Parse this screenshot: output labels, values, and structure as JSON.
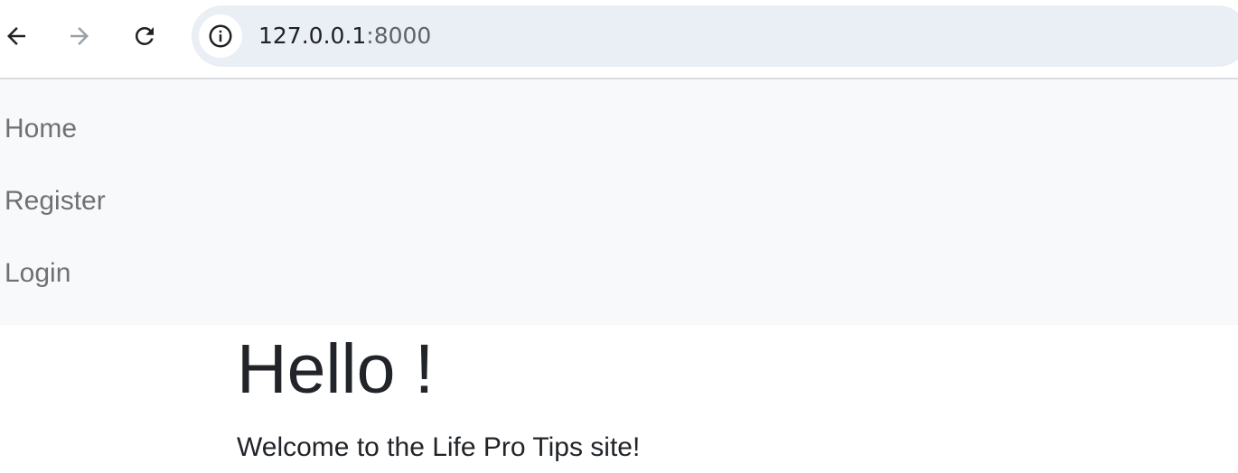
{
  "browser": {
    "back_icon": "arrow-left-icon",
    "forward_icon": "arrow-right-icon",
    "reload_icon": "reload-icon",
    "site_info_icon": "info-icon",
    "url_host": "127.0.0.1",
    "url_port": ":8000",
    "colors": {
      "omnibox_bg": "#eaeef5",
      "forward_disabled": "#9aa0a6",
      "icon": "#202124"
    }
  },
  "navbar": {
    "links": [
      {
        "label": "Home"
      },
      {
        "label": "Register"
      },
      {
        "label": "Login"
      }
    ],
    "colors": {
      "background": "#f8f9fa",
      "link": "#7b7d7f"
    }
  },
  "main": {
    "heading": "Hello !",
    "welcome": "Welcome to the Life Pro Tips site!",
    "text_color": "#212529"
  }
}
